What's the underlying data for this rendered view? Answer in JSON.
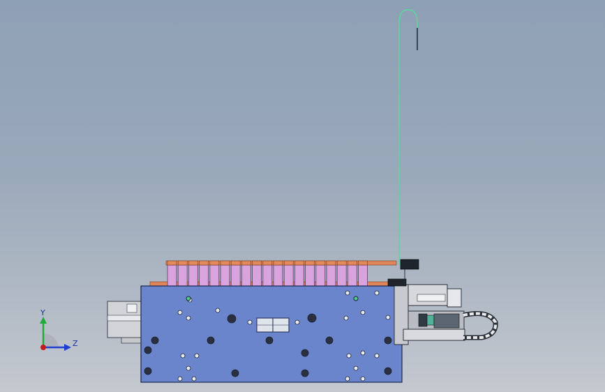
{
  "viewport": {
    "background_top": "#8ea0b5",
    "background_bottom": "#c4c9d0"
  },
  "model": {
    "base_plate_color": "#6a85cc",
    "cell_color": "#d9a3de",
    "cell_cap_color": "#e28a5a",
    "wire_color": "#3fd08a",
    "cell_count": 19,
    "label": ""
  },
  "triad": {
    "y_label": "Y",
    "z_label": "Z",
    "y_color": "#1faa3a",
    "z_color": "#1f3fd0",
    "x_color": "#c41c1c"
  }
}
